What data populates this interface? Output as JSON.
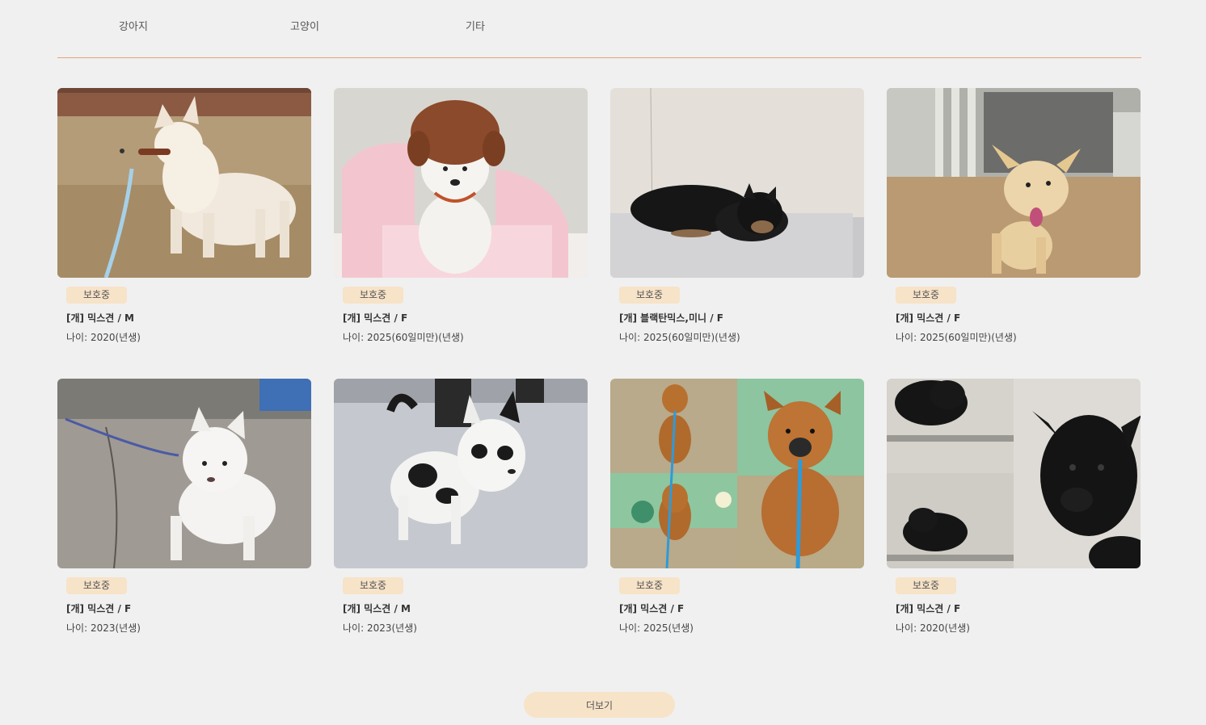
{
  "tabs": [
    {
      "label": "강아지"
    },
    {
      "label": "고양이"
    },
    {
      "label": "기타"
    }
  ],
  "colors": {
    "accent_line": "#e8a27a",
    "badge_bg": "#f7e3c8",
    "page_bg": "#f0f0f0"
  },
  "cards": [
    {
      "status": "보호중",
      "title": "[개] 믹스견 / M",
      "age": "나이: 2020(년생)",
      "photo_icon": "white-dog-on-grass-photo"
    },
    {
      "status": "보호중",
      "title": "[개] 믹스견 / F",
      "age": "나이: 2025(60일미만)(년생)",
      "photo_icon": "puppy-with-hat-photo"
    },
    {
      "status": "보호중",
      "title": "[개] 블랙탄믹스,미니 / F",
      "age": "나이: 2025(60일미만)(년생)",
      "photo_icon": "black-dog-lying-photo"
    },
    {
      "status": "보호중",
      "title": "[개] 믹스견 / F",
      "age": "나이: 2025(60일미만)(년생)",
      "photo_icon": "yellow-dog-shelter-photo"
    },
    {
      "status": "보호중",
      "title": "[개] 믹스견 / F",
      "age": "나이: 2023(년생)",
      "photo_icon": "white-dog-leash-photo"
    },
    {
      "status": "보호중",
      "title": "[개] 믹스견 / M",
      "age": "나이: 2023(년생)",
      "photo_icon": "black-white-dog-photo"
    },
    {
      "status": "보호중",
      "title": "[개] 믹스견 / F",
      "age": "나이: 2025(년생)",
      "photo_icon": "brown-puppy-collage-photo"
    },
    {
      "status": "보호중",
      "title": "[개] 믹스견 / F",
      "age": "나이: 2020(년생)",
      "photo_icon": "black-puppy-collage-photo"
    }
  ],
  "more_button": {
    "label": "더보기"
  }
}
